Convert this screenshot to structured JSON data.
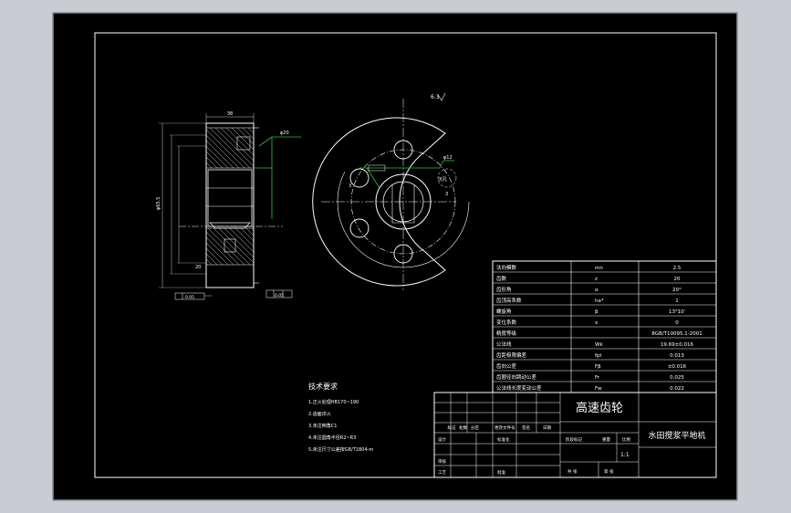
{
  "colors": {
    "screen_background": "#c9cdd3",
    "paper": "#000000",
    "line": "#ffffff",
    "dimension_line": "#22c83a"
  },
  "section_view": {
    "dim_top": "38",
    "dim_left": "φ65.5",
    "tolerance_left": "0.05",
    "tolerance_right": "0.05",
    "fit_label": "φ20",
    "mark_bottom": "20"
  },
  "face_view": {
    "corner_mark": "6.3",
    "hole_label": "φ12",
    "note_label": "沉孔",
    "mark_left": "3",
    "mark_right": "3"
  },
  "parameter_table": {
    "rows": [
      {
        "name": "法向模数",
        "symbol": "mn",
        "value": "2.5"
      },
      {
        "name": "齿数",
        "symbol": "z",
        "value": "20"
      },
      {
        "name": "齿形角",
        "symbol": "α",
        "value": "20°"
      },
      {
        "name": "齿顶高系数",
        "symbol": "ha*",
        "value": "1"
      },
      {
        "name": "螺旋角",
        "symbol": "β",
        "value": "13°10′"
      },
      {
        "name": "变位系数",
        "symbol": "x",
        "value": "0"
      },
      {
        "name": "精度等级",
        "symbol": "",
        "value": "8GB/T10095.1-2001"
      },
      {
        "name": "公法线",
        "symbol": "Wk",
        "value": "19.69±0.016"
      },
      {
        "name": "齿距极限偏差",
        "symbol": "fpt",
        "value": "0.013"
      },
      {
        "name": "齿向公差",
        "symbol": "Fβ",
        "value": "±0.016"
      },
      {
        "name": "齿圈径向跳动公差",
        "symbol": "Fr",
        "value": "0.025"
      },
      {
        "name": "公法线长度变动公差",
        "symbol": "Fw",
        "value": "0.022"
      }
    ]
  },
  "technical_requirements": {
    "title": "技术要求",
    "items": [
      "1.正火处理HB170~190",
      "2.齿面淬火",
      "3.未注倒角C1",
      "4.未注圆角半径R2~R3",
      "5.未注尺寸公差按GB/T1804-m"
    ]
  },
  "title_block": {
    "part_name": "高速齿轮",
    "assembly_name": "水田搅浆平地机",
    "row_labels": {
      "mark": "标记",
      "count": "处数",
      "zone": "分区",
      "change_doc": "更改文件号",
      "signature": "签名",
      "date": "日期",
      "design": "设计",
      "standardize": "标准化",
      "review": "审核",
      "process": "工艺",
      "approve": "批准",
      "stage_mark": "阶段标记",
      "weight": "重量",
      "scale": "比例",
      "scale_value": "1:1",
      "sheet_total": "共 张",
      "sheet_no": "第 张"
    }
  }
}
